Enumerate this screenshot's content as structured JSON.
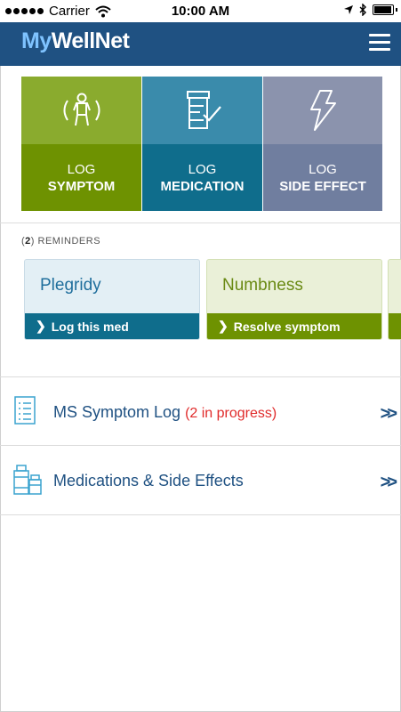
{
  "status_bar": {
    "carrier": "Carrier",
    "time": "10:00 AM"
  },
  "header": {
    "logo_part1": "My",
    "logo_part2": "WellNet"
  },
  "tiles": [
    {
      "line1": "LOG",
      "line2": "SYMPTOM",
      "icon": "person-icon",
      "top_color": "#8aab2e",
      "bottom_color": "#6e9201"
    },
    {
      "line1": "LOG",
      "line2": "MEDICATION",
      "icon": "medication-bottle-icon",
      "top_color": "#3a8bab",
      "bottom_color": "#0f6d8c"
    },
    {
      "line1": "LOG",
      "line2": "SIDE EFFECT",
      "icon": "lightning-icon",
      "top_color": "#8b93ad",
      "bottom_color": "#707e9f"
    }
  ],
  "reminders": {
    "count": "2",
    "label": "REMINDERS",
    "cards": [
      {
        "title": "Plegridy",
        "action": "Log this med",
        "title_color": "#1f6e9c",
        "bar_color": "#0f6d8c",
        "bg": "#e3eff5"
      },
      {
        "title": "Numbness",
        "action": "Resolve symptom",
        "title_color": "#6a8a14",
        "bar_color": "#6e9201",
        "bg": "#eaf0d8"
      }
    ]
  },
  "menu": [
    {
      "label": "MS Symptom Log",
      "progress": "(2 in progress)",
      "icon": "checklist-icon",
      "arrow": ">>"
    },
    {
      "label": "Medications & Side Effects",
      "progress": "",
      "icon": "pill-bottles-icon",
      "arrow": ">>"
    }
  ]
}
